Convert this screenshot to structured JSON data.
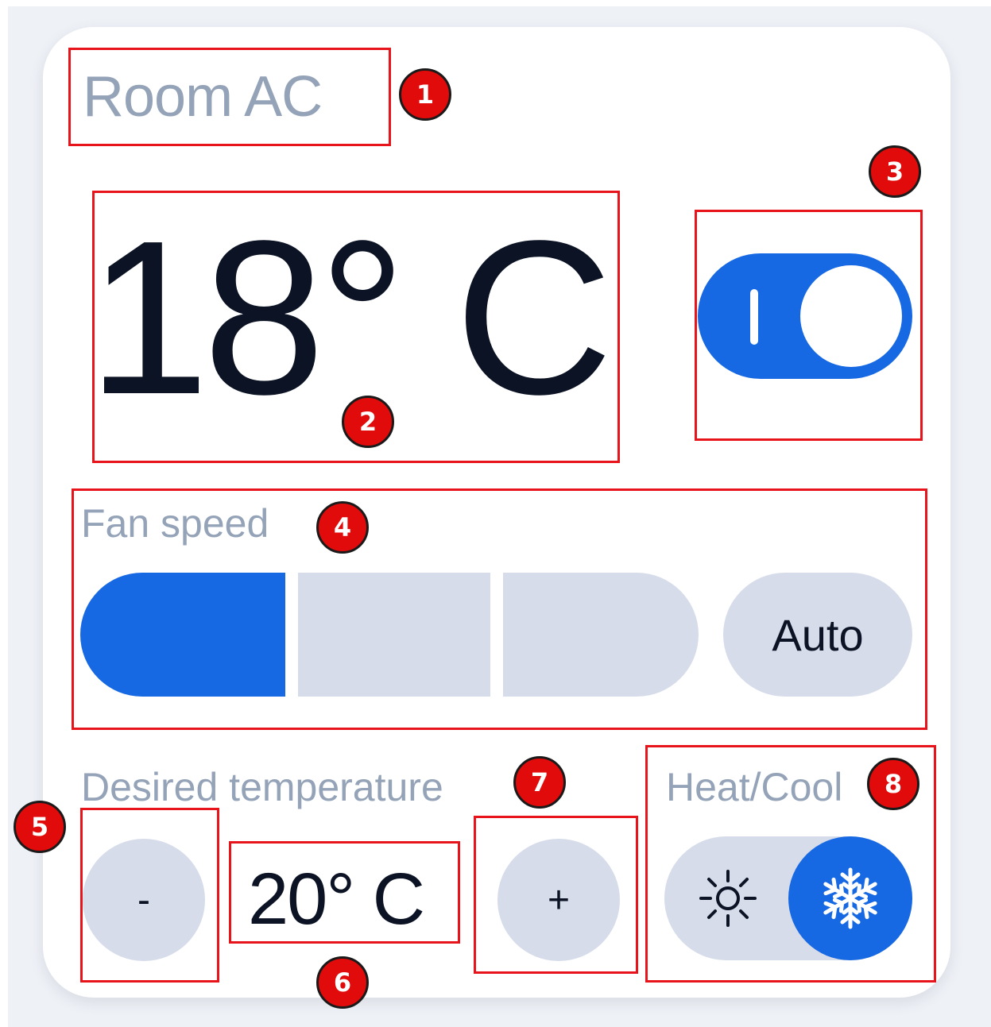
{
  "card": {
    "title": "Room AC",
    "current_temperature": "18° C",
    "power_on": true
  },
  "fan_speed": {
    "label": "Fan speed",
    "levels": 3,
    "active_level": 1,
    "auto_label": "Auto"
  },
  "desired_temperature": {
    "label": "Desired temperature",
    "value": "20° C",
    "minus_label": "-",
    "plus_label": "+"
  },
  "mode": {
    "label": "Heat/Cool",
    "selected": "cool",
    "heat_icon": "sun-icon",
    "cool_icon": "snowflake-icon"
  },
  "annotations": [
    "1",
    "2",
    "3",
    "4",
    "5",
    "6",
    "7",
    "8"
  ],
  "colors": {
    "accent": "#1668e3",
    "inactive": "#d6dcea",
    "label_text": "#94a3b8",
    "main_text": "#0b1324",
    "annotation_red": "#e10b0b"
  }
}
